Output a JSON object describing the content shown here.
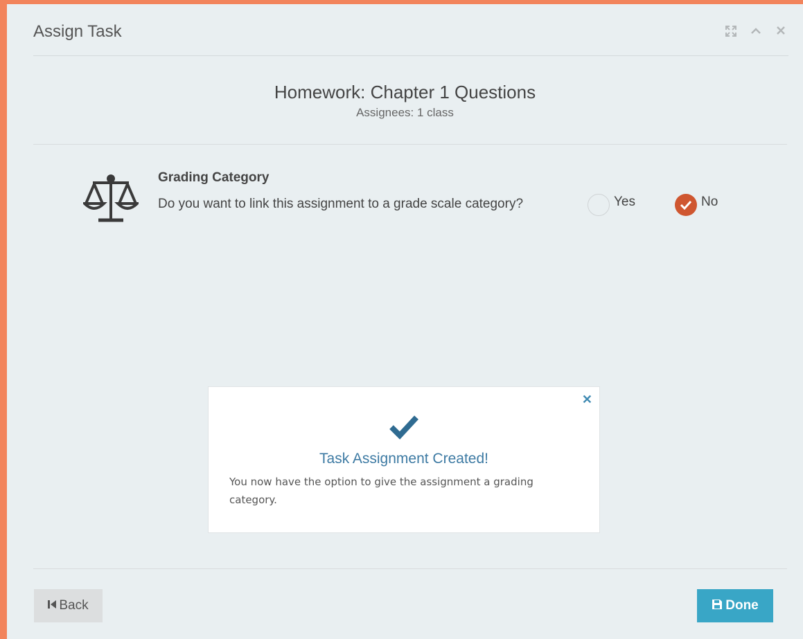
{
  "dialog": {
    "title": "Assign Task",
    "header_icons": [
      "expand-icon",
      "chevron-up-icon",
      "close-icon"
    ]
  },
  "task": {
    "title": "Homework: Chapter 1 Questions",
    "assignees": "Assignees: 1 class"
  },
  "grading": {
    "label": "Grading Category",
    "question": "Do you want to link this assignment to a grade scale category?",
    "options": [
      {
        "label": "Yes",
        "selected": false
      },
      {
        "label": "No",
        "selected": true
      }
    ],
    "accent_color": "#cf5630"
  },
  "toast": {
    "title": "Task Assignment Created!",
    "message": "You now have the option to give the assignment a grading category.",
    "accent_color": "#3d7aa3"
  },
  "footer": {
    "back_label": "Back",
    "done_label": "Done",
    "done_color": "#39a6c6"
  }
}
